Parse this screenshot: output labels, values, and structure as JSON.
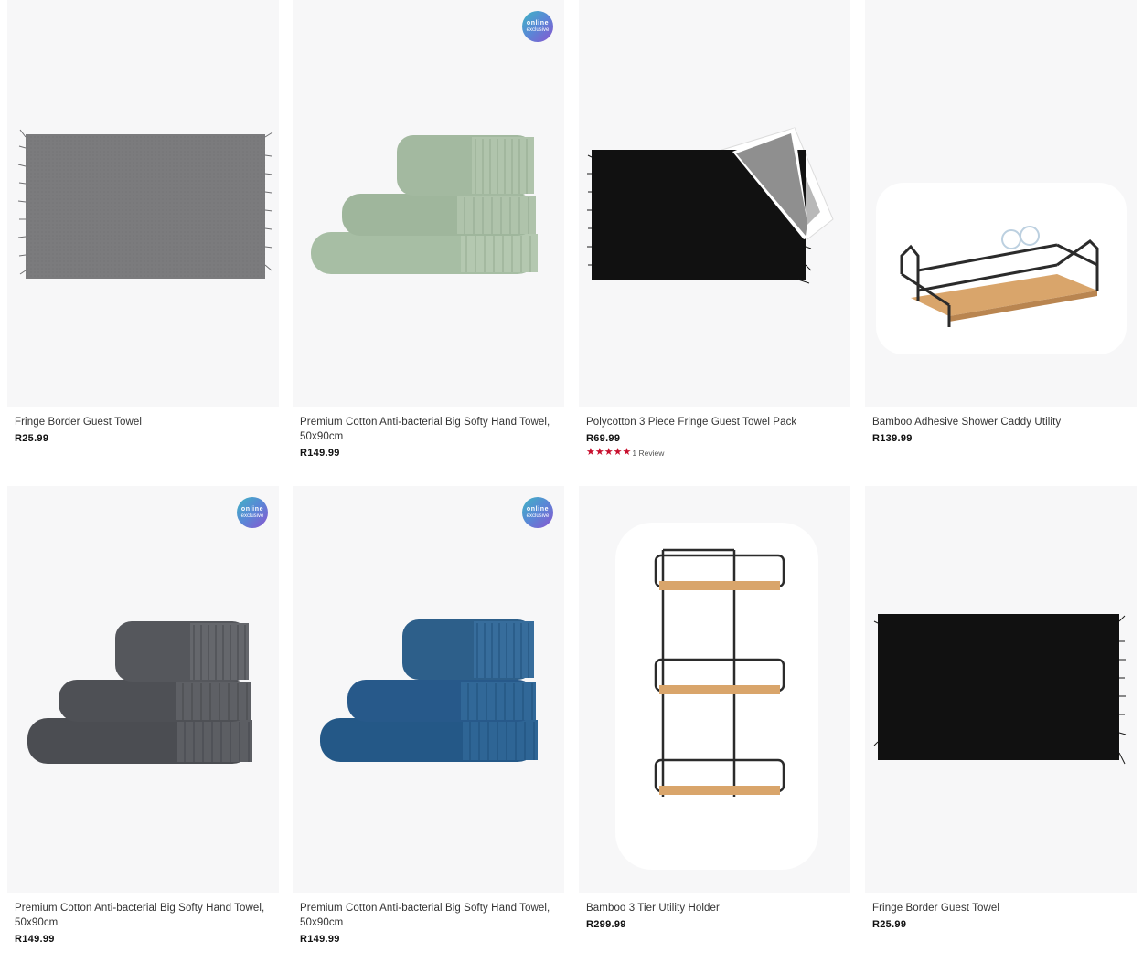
{
  "products": [
    {
      "title": "Fringe Border Guest Towel",
      "price": "R25.99",
      "badge": false
    },
    {
      "title": "Premium Cotton Anti-bacterial Big Softy Hand Towel, 50x90cm",
      "price": "R149.99",
      "badge": true,
      "color": "#a7bea4"
    },
    {
      "title": "Polycotton 3 Piece Fringe Guest Towel Pack",
      "price": "R69.99",
      "badge": false,
      "stars": 5,
      "review_text": "1 Review"
    },
    {
      "title": "Bamboo Adhesive Shower Caddy Utility",
      "price": "R139.99",
      "badge": false
    },
    {
      "title": "Premium Cotton Anti-bacterial Big Softy Hand Towel, 50x90cm",
      "price": "R149.99",
      "badge": true,
      "color": "#55575c"
    },
    {
      "title": "Premium Cotton Anti-bacterial Big Softy Hand Towel, 50x90cm",
      "price": "R149.99",
      "badge": true,
      "color": "#2d5f8a"
    },
    {
      "title": "Bamboo 3 Tier Utility Holder",
      "price": "R299.99",
      "badge": false
    },
    {
      "title": "Fringe Border Guest Towel",
      "price": "R25.99",
      "badge": false
    }
  ],
  "badge": {
    "line1": "online",
    "line2": "exclusive"
  },
  "colors": {
    "star": "#c8102e",
    "image_bg": "#f7f7f8",
    "grey_towel": "#7b7b7d",
    "black_towel": "#111111",
    "bamboo": "#d9a56b",
    "frame": "#2b2b2b"
  },
  "icons": {
    "star": "star-icon"
  }
}
